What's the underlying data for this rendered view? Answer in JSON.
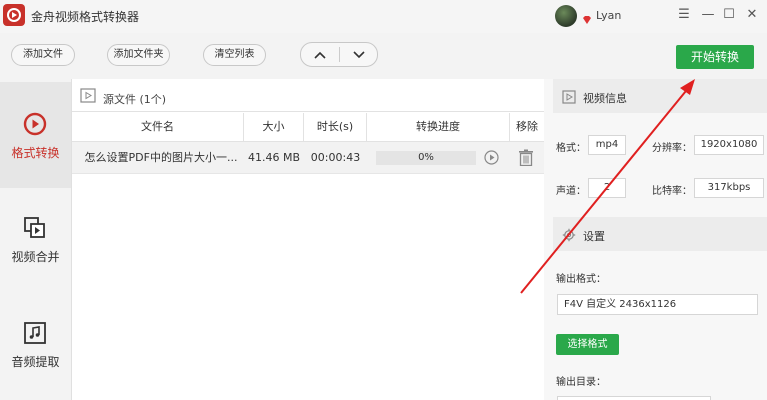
{
  "app": {
    "title": "金舟视频格式转换器",
    "username": "Lyan",
    "window_controls": {
      "menu": "☰",
      "minimize": "—",
      "maximize": "☐",
      "close": "✕"
    }
  },
  "toolbar": {
    "add_file": "添加文件",
    "add_folder": "添加文件夹",
    "clear_list": "清空列表",
    "move_up": "⌃",
    "move_down": "⌄",
    "start_convert": "开始转换"
  },
  "sidebar": {
    "items": [
      {
        "label": "格式转换",
        "icon": "format-convert-icon",
        "active": true
      },
      {
        "label": "视频合并",
        "icon": "video-merge-icon",
        "active": false
      },
      {
        "label": "音频提取",
        "icon": "audio-extract-icon",
        "active": false
      }
    ]
  },
  "file_list": {
    "source_label": "源文件 (1个)",
    "columns": {
      "name": "文件名",
      "size": "大小",
      "duration": "时长(s)",
      "progress": "转换进度",
      "remove": "移除"
    },
    "rows": [
      {
        "name": "怎么设置PDF中的图片大小一...",
        "size": "41.46 MB",
        "duration": "00:00:43",
        "progress_text": "0%",
        "progress": 0
      }
    ]
  },
  "video_info": {
    "title": "视频信息",
    "format_label": "格式：",
    "format_value": "mp4",
    "resolution_label": "分辨率：",
    "resolution_value": "1920x1080",
    "channel_label": "声道：",
    "channel_value": "2",
    "bitrate_label": "比特率：",
    "bitrate_value": "317kbps"
  },
  "settings": {
    "title": "设置",
    "output_format_label": "输出格式：",
    "output_format_value": "F4V 自定义 2436x1126",
    "choose_format": "选择格式",
    "output_dir_label": "输出目录："
  },
  "colors": {
    "accent_green": "#2aa84a",
    "brand_red": "#c8312a",
    "annotation_red": "#e02020"
  }
}
